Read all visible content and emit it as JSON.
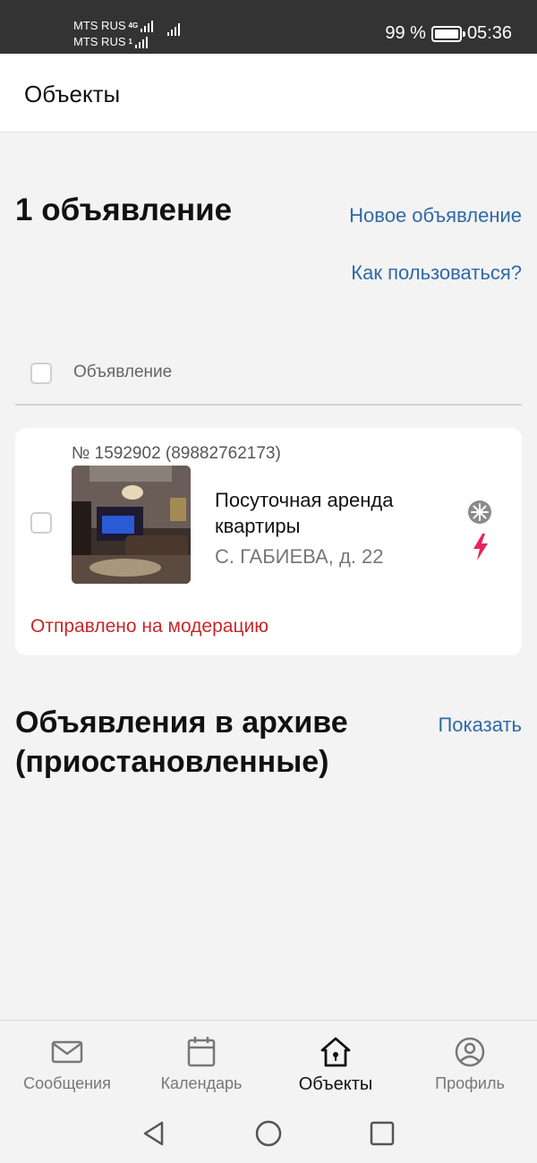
{
  "status_bar": {
    "carrier_1": "MTS RUS",
    "carrier_1_tag": "4G",
    "carrier_2": "MTS RUS",
    "carrier_2_tag": "1",
    "battery": "99 %",
    "time": "05:36"
  },
  "app_bar": {
    "title": "Объекты"
  },
  "listings": {
    "count_title": "1 объявление",
    "new_link": "Новое объявление",
    "help_link": "Как пользоваться?",
    "select_all_label": "Объявление",
    "items": [
      {
        "number": "№ 1592902 (89882762173)",
        "title": "Посуточная аренда квартиры",
        "address": "С. ГАБИЕВА, д. 22",
        "status": "Отправлено на модерацию",
        "status_color": "#c62828"
      }
    ]
  },
  "archive": {
    "title": "Объявления в архиве (приостановленные)",
    "show_link": "Показать"
  },
  "bottom_nav": {
    "items": [
      {
        "label": "Сообщения",
        "icon": "envelope-icon"
      },
      {
        "label": "Календарь",
        "icon": "calendar-icon"
      },
      {
        "label": "Объекты",
        "icon": "home-icon",
        "active": true
      },
      {
        "label": "Профиль",
        "icon": "profile-icon"
      }
    ]
  },
  "colors": {
    "link": "#2f6aa6",
    "accent_bolt": "#e8245a",
    "status_bar": "#333333"
  }
}
